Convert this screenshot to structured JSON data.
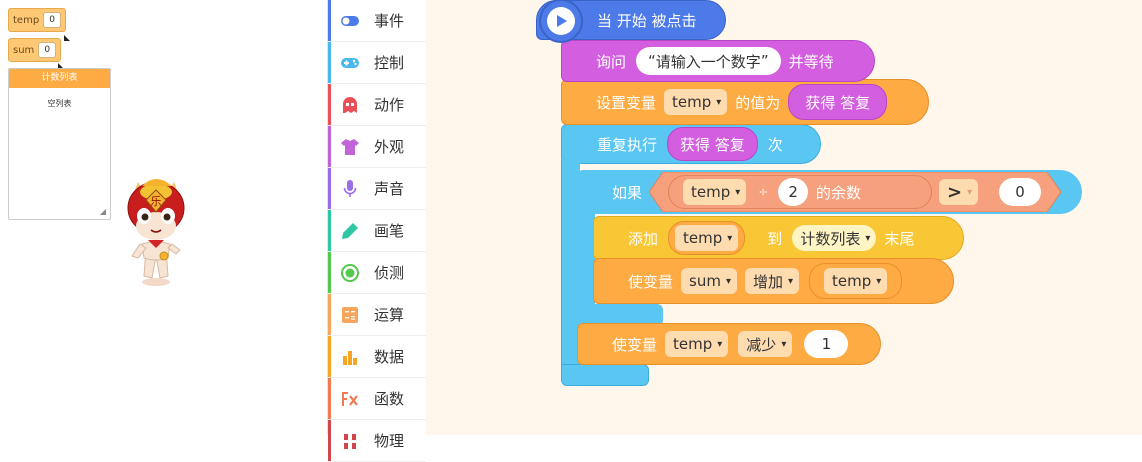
{
  "stage": {
    "monitors": {
      "temp": {
        "label": "temp",
        "value": "0"
      },
      "sum": {
        "label": "sum",
        "value": "0"
      }
    },
    "list_monitor": {
      "title": "计数列表",
      "empty_text": "空列表"
    },
    "sprite_icon": "cat-hero-sprite"
  },
  "categories": [
    {
      "label": "事件",
      "icon": "event-toggle-icon",
      "color": "#4c7ae8"
    },
    {
      "label": "控制",
      "icon": "gamepad-icon",
      "color": "#49b8ef"
    },
    {
      "label": "动作",
      "icon": "ghost-icon",
      "color": "#ea5058"
    },
    {
      "label": "外观",
      "icon": "shirt-icon",
      "color": "#c264d8"
    },
    {
      "label": "声音",
      "icon": "microphone-icon",
      "color": "#9a6de6"
    },
    {
      "label": "画笔",
      "icon": "pen-icon",
      "color": "#2dc7a3"
    },
    {
      "label": "侦测",
      "icon": "target-icon",
      "color": "#53c84d"
    },
    {
      "label": "运算",
      "icon": "calculator-icon",
      "color": "#f6a55b"
    },
    {
      "label": "数据",
      "icon": "bar-chart-icon",
      "color": "#f6a623"
    },
    {
      "label": "函数",
      "icon": "function-icon",
      "color": "#f07b52"
    },
    {
      "label": "物理",
      "icon": "physics-icon",
      "color": "#d0464a"
    }
  ],
  "blocks": {
    "hat": {
      "label": "当 开始 被点击",
      "icon": "play-icon"
    },
    "ask": {
      "prefix": "询问",
      "question": "请输入一个数字",
      "suffix": "并等待"
    },
    "set": {
      "prefix": "设置变量",
      "var": "temp",
      "mid": "的值为",
      "value": "获得 答复"
    },
    "repeat": {
      "prefix": "重复执行",
      "times": "获得 答复",
      "suffix": "次"
    },
    "if": {
      "prefix": "如果",
      "left_var": "temp",
      "op_div": "÷",
      "divisor": "2",
      "mod_label": "的余数",
      "cmp": ">",
      "rhs": "0"
    },
    "add": {
      "prefix": "添加",
      "value": "temp",
      "mid": "到",
      "list": "计数列表",
      "suffix": "末尾"
    },
    "change_sum": {
      "prefix": "使变量",
      "var": "sum",
      "action": "增加",
      "value": "temp"
    },
    "change_temp": {
      "prefix": "使变量",
      "var": "temp",
      "action": "减少",
      "value": "1"
    }
  },
  "colors": {
    "events": "#4c7ae8",
    "looks": "#d35ee0",
    "data": "#ffab44",
    "control": "#5ac6f2",
    "operators": "#f6a07d",
    "list": "#f9c736"
  }
}
